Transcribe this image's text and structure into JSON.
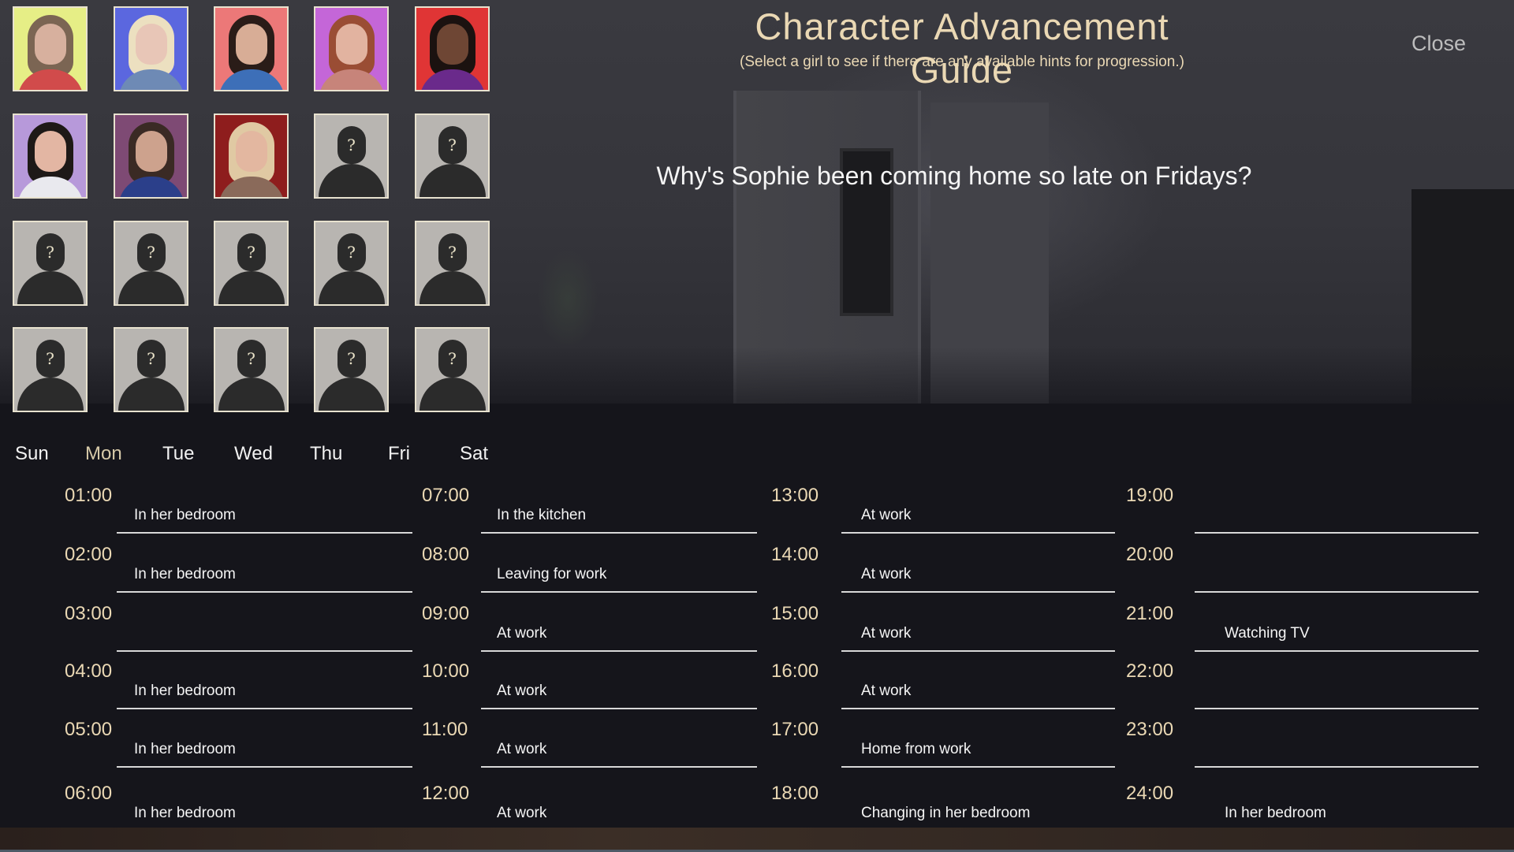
{
  "header": {
    "title": "Character Advancement Guide",
    "subtitle": "(Select a girl to see if there are any available hints for progression.)",
    "close_label": "Close"
  },
  "hint": "Why's Sophie been coming home so late on Fridays?",
  "portraits": {
    "unknown_symbol": "?",
    "known": [
      {
        "bg": "#e6ee86",
        "hair": "#7b6553",
        "skin": "#d7b09e",
        "top": "#d14b4b"
      },
      {
        "bg": "#5b67df",
        "hair": "#ece0c0",
        "skin": "#e8c6b7",
        "top": "#6e8ab5"
      },
      {
        "bg": "#ec7878",
        "hair": "#2a1c18",
        "skin": "#d8ad96",
        "top": "#3d6fb8"
      },
      {
        "bg": "#c466d8",
        "hair": "#9a4d34",
        "skin": "#e2b3a0",
        "top": "#c7847a"
      },
      {
        "bg": "#e03535",
        "hair": "#1b1210",
        "skin": "#6e4634",
        "top": "#6a2a8b"
      },
      {
        "bg": "#b799da",
        "hair": "#1e1917",
        "skin": "#e3b6a3",
        "top": "#e9e9ee"
      },
      {
        "bg": "#7e4a74",
        "hair": "#3a2a24",
        "skin": "#cda28d",
        "top": "#2b3f8a"
      },
      {
        "bg": "#8e1d1d",
        "hair": "#e0c9a3",
        "skin": "#e3b7a0",
        "top": "#8a6a5a"
      }
    ]
  },
  "days": {
    "items": [
      "Sun",
      "Mon",
      "Tue",
      "Wed",
      "Thu",
      "Fri",
      "Sat"
    ],
    "selected": "Mon"
  },
  "schedule": {
    "col1": [
      {
        "time": "01:00",
        "activity": "In her bedroom"
      },
      {
        "time": "02:00",
        "activity": "In her bedroom"
      },
      {
        "time": "03:00",
        "activity": ""
      },
      {
        "time": "04:00",
        "activity": "In her bedroom"
      },
      {
        "time": "05:00",
        "activity": "In her bedroom"
      },
      {
        "time": "06:00",
        "activity": "In her bedroom"
      }
    ],
    "col2": [
      {
        "time": "07:00",
        "activity": "In the kitchen"
      },
      {
        "time": "08:00",
        "activity": "Leaving for work"
      },
      {
        "time": "09:00",
        "activity": "At work"
      },
      {
        "time": "10:00",
        "activity": "At work"
      },
      {
        "time": "11:00",
        "activity": "At work"
      },
      {
        "time": "12:00",
        "activity": "At work"
      }
    ],
    "col3": [
      {
        "time": "13:00",
        "activity": "At work"
      },
      {
        "time": "14:00",
        "activity": "At work"
      },
      {
        "time": "15:00",
        "activity": "At work"
      },
      {
        "time": "16:00",
        "activity": "At work"
      },
      {
        "time": "17:00",
        "activity": "Home from work"
      },
      {
        "time": "18:00",
        "activity": "Changing in her bedroom"
      }
    ],
    "col4": [
      {
        "time": "19:00",
        "activity": ""
      },
      {
        "time": "20:00",
        "activity": ""
      },
      {
        "time": "21:00",
        "activity": "Watching TV"
      },
      {
        "time": "22:00",
        "activity": ""
      },
      {
        "time": "23:00",
        "activity": ""
      },
      {
        "time": "24:00",
        "activity": "In her bedroom"
      }
    ]
  }
}
